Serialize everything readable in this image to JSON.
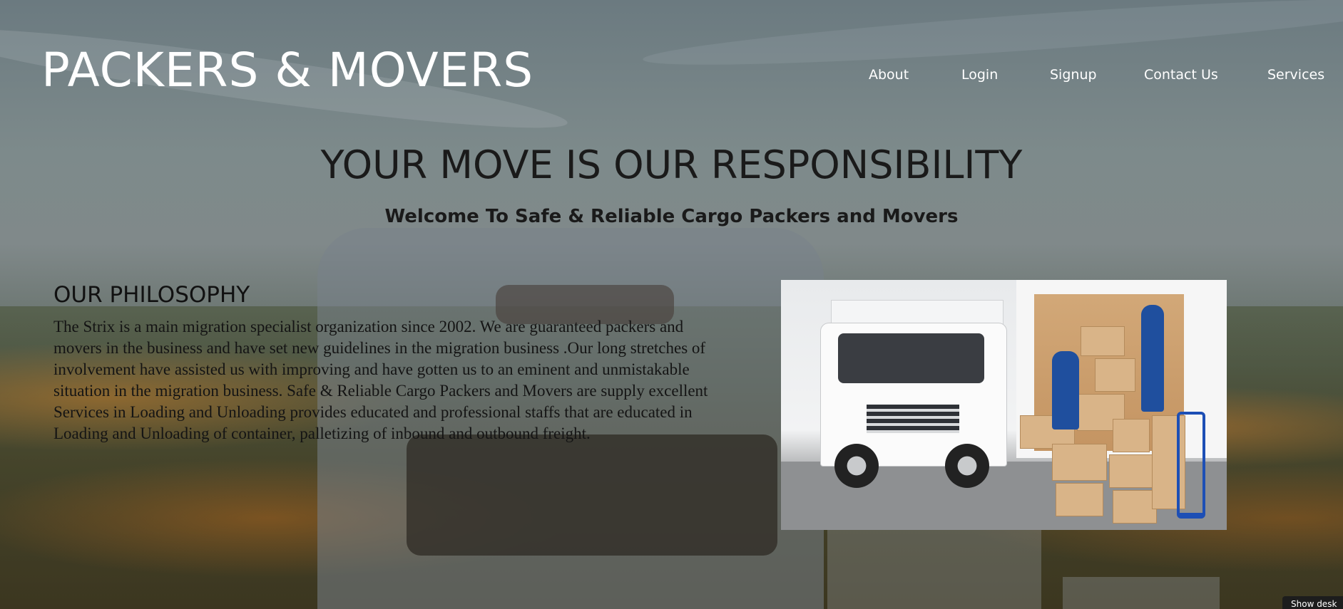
{
  "header": {
    "brand": "PACKERS & MOVERS",
    "nav": [
      "About",
      "Login",
      "Signup",
      "Contact Us",
      "Services"
    ]
  },
  "hero": {
    "title": "YOUR MOVE IS OUR RESPONSIBILITY",
    "subtitle": "Welcome To Safe & Reliable Cargo Packers and Movers"
  },
  "philosophy": {
    "heading": "OUR PHILOSOPHY",
    "text": "The Strix is a main migration specialist organization since 2002. We are guaranteed packers and movers in the business and have set new guidelines in the migration business .Our long stretches of involvement have assisted us with improving and have gotten us to an eminent and unmistakable situation in the migration business. Safe & Reliable Cargo Packers and Movers are supply excellent Services in Loading and Unloading provides educated and professional staffs that are educated in Loading and Unloading of container, palletizing of inbound and outbound freight."
  },
  "corner_tab": {
    "label": "Show desk"
  }
}
